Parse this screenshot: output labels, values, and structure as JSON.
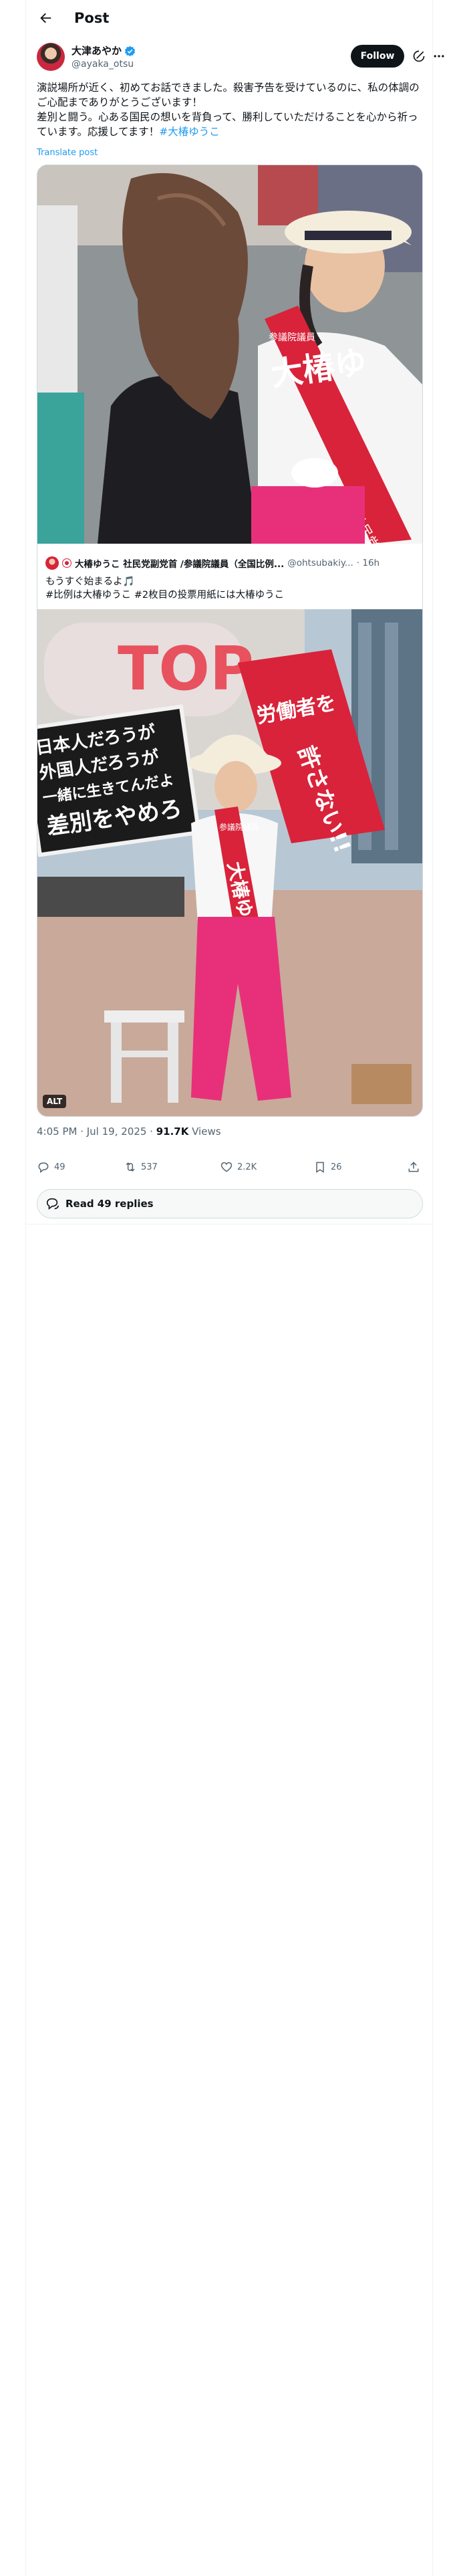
{
  "header": {
    "title": "Post"
  },
  "author": {
    "name": "大津あやか",
    "handle": "@ayaka_otsu",
    "follow_label": "Follow"
  },
  "post": {
    "line1": "演説場所が近く、初めてお話できました。殺害予告を受けているのに、私の体調のご心配までありがとうございます！",
    "line2_prefix": "差別と闘う。心ある国民の想いを背負って、勝利していただけることを心から祈っています。応援してます！",
    "hashtag": "#大椿ゆうこ",
    "translate_label": "Translate post"
  },
  "quote": {
    "name": "大椿ゆうこ 社民党副党首 /参議院議員（全国比例...",
    "handle": "@ohtsubakiy...",
    "time": "· 16h",
    "line1": "もうすぐ始まるよ🎵",
    "line2": "#比例は大椿ゆうこ #2枚目の投票用紙には大椿ゆうこ",
    "alt_label": "ALT"
  },
  "photo1_signs": {
    "sash_top": "参議院議員",
    "sash_name": "大椿ゆ",
    "sash_party": "社民党"
  },
  "photo2_signs": {
    "placard_line1": "日本人だろうが",
    "placard_line2": "外国人だろうが",
    "placard_line3": "一緒に生きてんだよ",
    "placard_line4": "差別をやめろ",
    "banner_text": "許さない!!",
    "banner_text2": "労働者を",
    "sash_top": "参議院議員",
    "sash_name": "大椿ゆうこ",
    "storefront": "TOP"
  },
  "meta": {
    "time": "4:05 PM · Jul 19, 2025 · ",
    "views_count": "91.7K",
    "views_label": " Views"
  },
  "actions": {
    "replies": "49",
    "reposts": "537",
    "likes": "2.2K",
    "bookmarks": "26"
  },
  "read_replies_label": "Read 49 replies",
  "icons": {
    "back": "arrow-left-icon",
    "verified": "verified-badge-icon",
    "grok": "grok-icon",
    "more": "more-icon",
    "reply": "reply-icon",
    "repost": "repost-icon",
    "like": "heart-icon",
    "bookmark": "bookmark-icon",
    "share": "share-icon",
    "replies_bubble": "replies-bubble-icon"
  },
  "colors": {
    "accent": "#1d9bf0",
    "text": "#0f1419",
    "muted": "#536471",
    "sash_red": "#d8233a",
    "pants_pink": "#e8307a"
  }
}
